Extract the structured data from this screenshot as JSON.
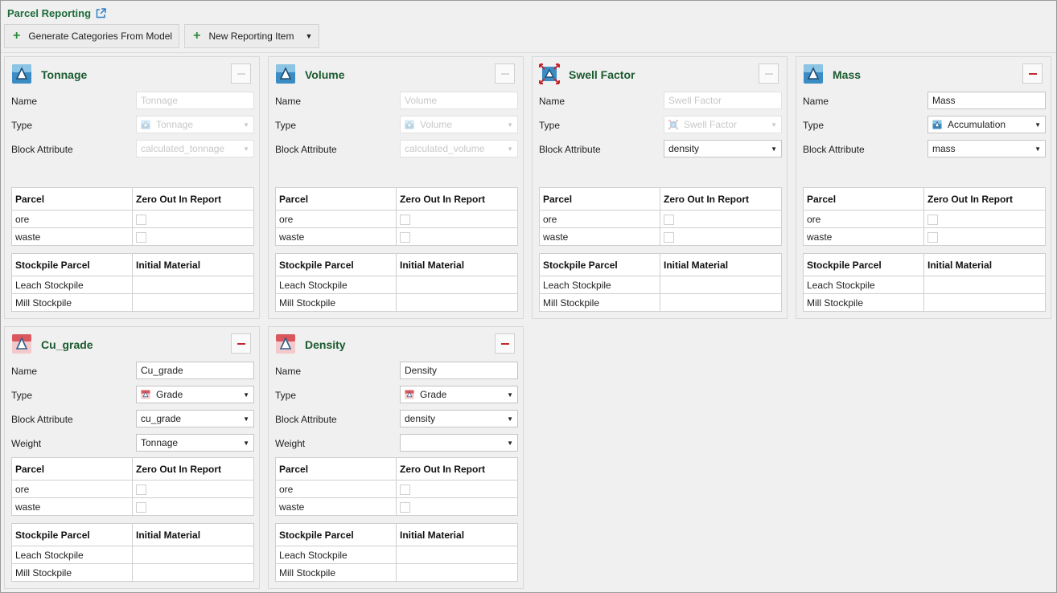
{
  "header": {
    "title": "Parcel Reporting"
  },
  "toolbar": {
    "generate_label": "Generate Categories From Model",
    "new_item_label": "New Reporting Item"
  },
  "labels": {
    "name": "Name",
    "type": "Type",
    "block_attribute": "Block Attribute",
    "weight": "Weight",
    "parcel_header": "Parcel",
    "zero_out_header": "Zero Out In Report",
    "stockpile_header": "Stockpile Parcel",
    "initial_header": "Initial Material"
  },
  "colors": {
    "title_green": "#1a5a2f",
    "remove_red": "#c0282d",
    "plus_green": "#2e8b3c"
  },
  "cards": [
    {
      "title": "Tonnage",
      "icon": "accumulation-icon",
      "name_value": "Tonnage",
      "type_value": "Tonnage",
      "type_icon": "accumulation-icon",
      "attr_value": "calculated_tonnage",
      "disabled": true,
      "removable": false,
      "parcels": [
        "ore",
        "waste"
      ],
      "stockpiles": [
        "Leach Stockpile",
        "Mill Stockpile"
      ]
    },
    {
      "title": "Volume",
      "icon": "accumulation-icon",
      "name_value": "Volume",
      "type_value": "Volume",
      "type_icon": "accumulation-icon",
      "attr_value": "calculated_volume",
      "disabled": true,
      "removable": false,
      "parcels": [
        "ore",
        "waste"
      ],
      "stockpiles": [
        "Leach Stockpile",
        "Mill Stockpile"
      ]
    },
    {
      "title": "Swell Factor",
      "icon": "swell-factor-icon",
      "name_value": "Swell Factor",
      "type_value": "Swell Factor",
      "type_icon": "swell-factor-icon",
      "attr_value": "density",
      "disabled": true,
      "attr_enabled": true,
      "removable": false,
      "parcels": [
        "ore",
        "waste"
      ],
      "stockpiles": [
        "Leach Stockpile",
        "Mill Stockpile"
      ]
    },
    {
      "title": "Mass",
      "icon": "accumulation-icon",
      "name_value": "Mass",
      "type_value": "Accumulation",
      "type_icon": "accumulation-icon",
      "attr_value": "mass",
      "disabled": false,
      "removable": true,
      "parcels": [
        "ore",
        "waste"
      ],
      "stockpiles": [
        "Leach Stockpile",
        "Mill Stockpile"
      ]
    },
    {
      "title": "Cu_grade",
      "icon": "grade-icon",
      "name_value": "Cu_grade",
      "type_value": "Grade",
      "type_icon": "grade-icon",
      "attr_value": "cu_grade",
      "weight_value": "Tonnage",
      "disabled": false,
      "removable": true,
      "parcels": [
        "ore",
        "waste"
      ],
      "stockpiles": [
        "Leach Stockpile",
        "Mill Stockpile"
      ]
    },
    {
      "title": "Density",
      "icon": "grade-icon",
      "name_value": "Density",
      "type_value": "Grade",
      "type_icon": "grade-icon",
      "attr_value": "density",
      "weight_value": "",
      "disabled": false,
      "removable": true,
      "parcels": [
        "ore",
        "waste"
      ],
      "stockpiles": [
        "Leach Stockpile",
        "Mill Stockpile"
      ]
    }
  ]
}
